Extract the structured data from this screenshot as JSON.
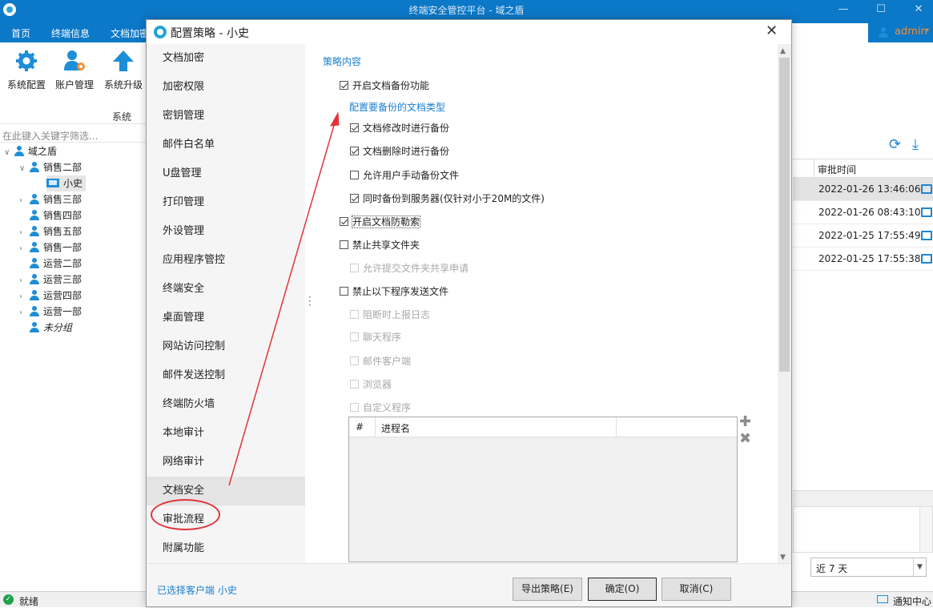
{
  "window": {
    "title": "终端安全管控平台 - 域之盾"
  },
  "menu": [
    "首页",
    "终端信息",
    "文档加密"
  ],
  "user": {
    "name": "admin"
  },
  "ribbon": {
    "buttons": [
      "系统配置",
      "账户管理",
      "系统升级"
    ],
    "group": "系统"
  },
  "filter": {
    "placeholder": "在此键入关键字筛选..."
  },
  "tree": {
    "root": "域之盾",
    "expanded": "销售二部",
    "selected": "小史",
    "groups": [
      "销售三部",
      "销售四部",
      "销售五部",
      "销售一部",
      "运营二部",
      "运营三部",
      "运营四部",
      "运营一部"
    ],
    "ungrouped": "未分组"
  },
  "grid": {
    "header": "审批时间",
    "rows": [
      "2022-01-26 13:46:06",
      "2022-01-26 08:43:10",
      "2022-01-25 17:55:49",
      "2022-01-25 17:55:38"
    ]
  },
  "range": "近 7 天",
  "status": {
    "left": "就绪",
    "right": "通知中心"
  },
  "dialog": {
    "title": "配置策略 - 小史",
    "categories": [
      "文档加密",
      "加密权限",
      "密钥管理",
      "邮件白名单",
      "U盘管理",
      "打印管理",
      "外设管理",
      "应用程序管控",
      "终端安全",
      "桌面管理",
      "网站访问控制",
      "邮件发送控制",
      "终端防火墙",
      "本地审计",
      "网络审计",
      "文档安全",
      "审批流程",
      "附属功能"
    ],
    "selected_category": "文档安全",
    "section_title": "策略内容",
    "options": {
      "enable_backup": "开启文档备份功能",
      "config_types_link": "配置要备份的文档类型",
      "backup_on_modify": "文档修改时进行备份",
      "backup_on_delete": "文档删除时进行备份",
      "allow_manual": "允许用户手动备份文件",
      "sync_server": "同时备份到服务器(仅针对小于20M的文件)",
      "anti_ransom": "开启文档防勒索",
      "forbid_share": "禁止共享文件夹",
      "allow_share_request": "允许提交文件夹共享申请",
      "forbid_programs": "禁止以下程序发送文件",
      "log_on_block": "阻断时上报日志",
      "chat": "聊天程序",
      "mail_client": "邮件客户端",
      "browser": "浏览器",
      "custom": "自定义程序"
    },
    "table": {
      "col_index": "#",
      "col_process": "进程名"
    },
    "footer": {
      "selected_client": "已选择客户端 小史",
      "export": "导出策略(E)",
      "ok": "确定(O)",
      "cancel": "取消(C)"
    }
  },
  "colors": {
    "primary": "#0b78c8",
    "accent": "#1a7fcf",
    "admin": "#f48c35",
    "highlight_ring": "#e2353a"
  }
}
